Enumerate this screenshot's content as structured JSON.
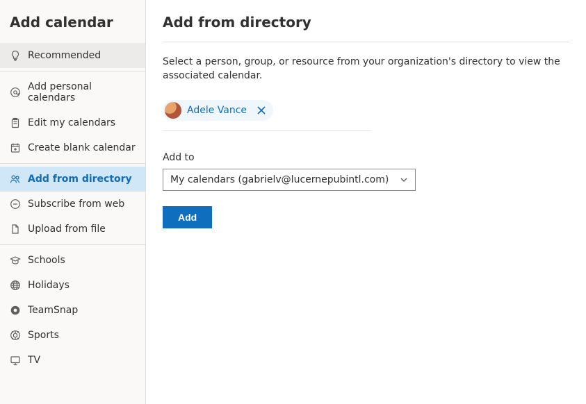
{
  "sidebar": {
    "title": "Add calendar",
    "groups": [
      [
        {
          "icon": "lightbulb",
          "label": "Recommended",
          "highlight": true
        }
      ],
      [
        {
          "icon": "at-sign",
          "label": "Add personal calendars"
        },
        {
          "icon": "clipboard",
          "label": "Edit my calendars"
        },
        {
          "icon": "calendar-plus",
          "label": "Create blank calendar"
        }
      ],
      [
        {
          "icon": "people",
          "label": "Add from directory",
          "active": true
        },
        {
          "icon": "globe-minus",
          "label": "Subscribe from web"
        },
        {
          "icon": "file",
          "label": "Upload from file"
        }
      ],
      [
        {
          "icon": "grad-cap",
          "label": "Schools"
        },
        {
          "icon": "globe",
          "label": "Holidays"
        },
        {
          "icon": "teamsnap",
          "label": "TeamSnap"
        },
        {
          "icon": "sports",
          "label": "Sports"
        },
        {
          "icon": "tv",
          "label": "TV"
        }
      ]
    ]
  },
  "page": {
    "title": "Add from directory",
    "description": "Select a person, group, or resource from your organization's directory to view the associated calendar."
  },
  "selectedPerson": {
    "name": "Adele Vance"
  },
  "addTo": {
    "label": "Add to",
    "value": "My calendars (gabrielv@lucernepubintl.com)"
  },
  "buttons": {
    "add": "Add"
  }
}
